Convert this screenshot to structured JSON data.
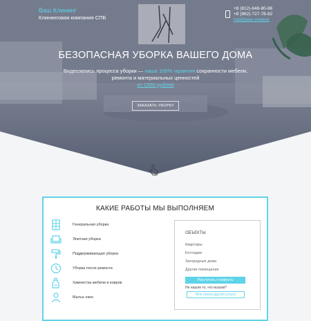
{
  "brand": {
    "name": "Ваш Клининг",
    "subtitle": "Клининговая компания СПБ"
  },
  "contacts": {
    "phones": [
      "+8 (812)-648-80-86",
      "+8 (962)-727-78-82"
    ],
    "email": "mail@ваш-клининг"
  },
  "hero": {
    "title": "БЕЗОПАСНАЯ УБОРКА ВАШЕГО ДОМА",
    "lead_part1": "Видеозапись процесса уборки — ",
    "lead_accent": "наша 100% гарантия",
    "lead_part2": " сохранности мебели, ремонта и материальных ценностей",
    "lead_price": "от 1500 рублей",
    "order_button": "ЗАКАЗАТЬ УБОРКУ"
  },
  "services": {
    "title": "КАКИЕ РАБОТЫ МЫ ВЫПОЛНЯЕМ",
    "items": [
      {
        "label": "Генеральная уборка",
        "icon": "window-icon"
      },
      {
        "label": "Элитная уборка",
        "icon": "armchair-icon"
      },
      {
        "label": "Поддерживающая уборка",
        "icon": "paint-roller-icon"
      },
      {
        "label": "Уборка после ремонта",
        "icon": "clock-icon"
      },
      {
        "label": "Химчистка мебели и ковров",
        "icon": "spray-icon"
      },
      {
        "label": "Мытье окон",
        "icon": "cleaner-person-icon"
      }
    ]
  },
  "objects": {
    "title": "ОБЪЕКТЫ",
    "options": [
      "Квартиры",
      "Коттеджи",
      "Загородные дома",
      "Другие помещения"
    ],
    "calc_button": "Рассчитать стоимость",
    "not_found": "Не нашли то, что искали?",
    "other_button": "Мне нужна другая услуга"
  },
  "colors": {
    "accent": "#5fd3e8",
    "hero_overlay": "#464e64"
  }
}
